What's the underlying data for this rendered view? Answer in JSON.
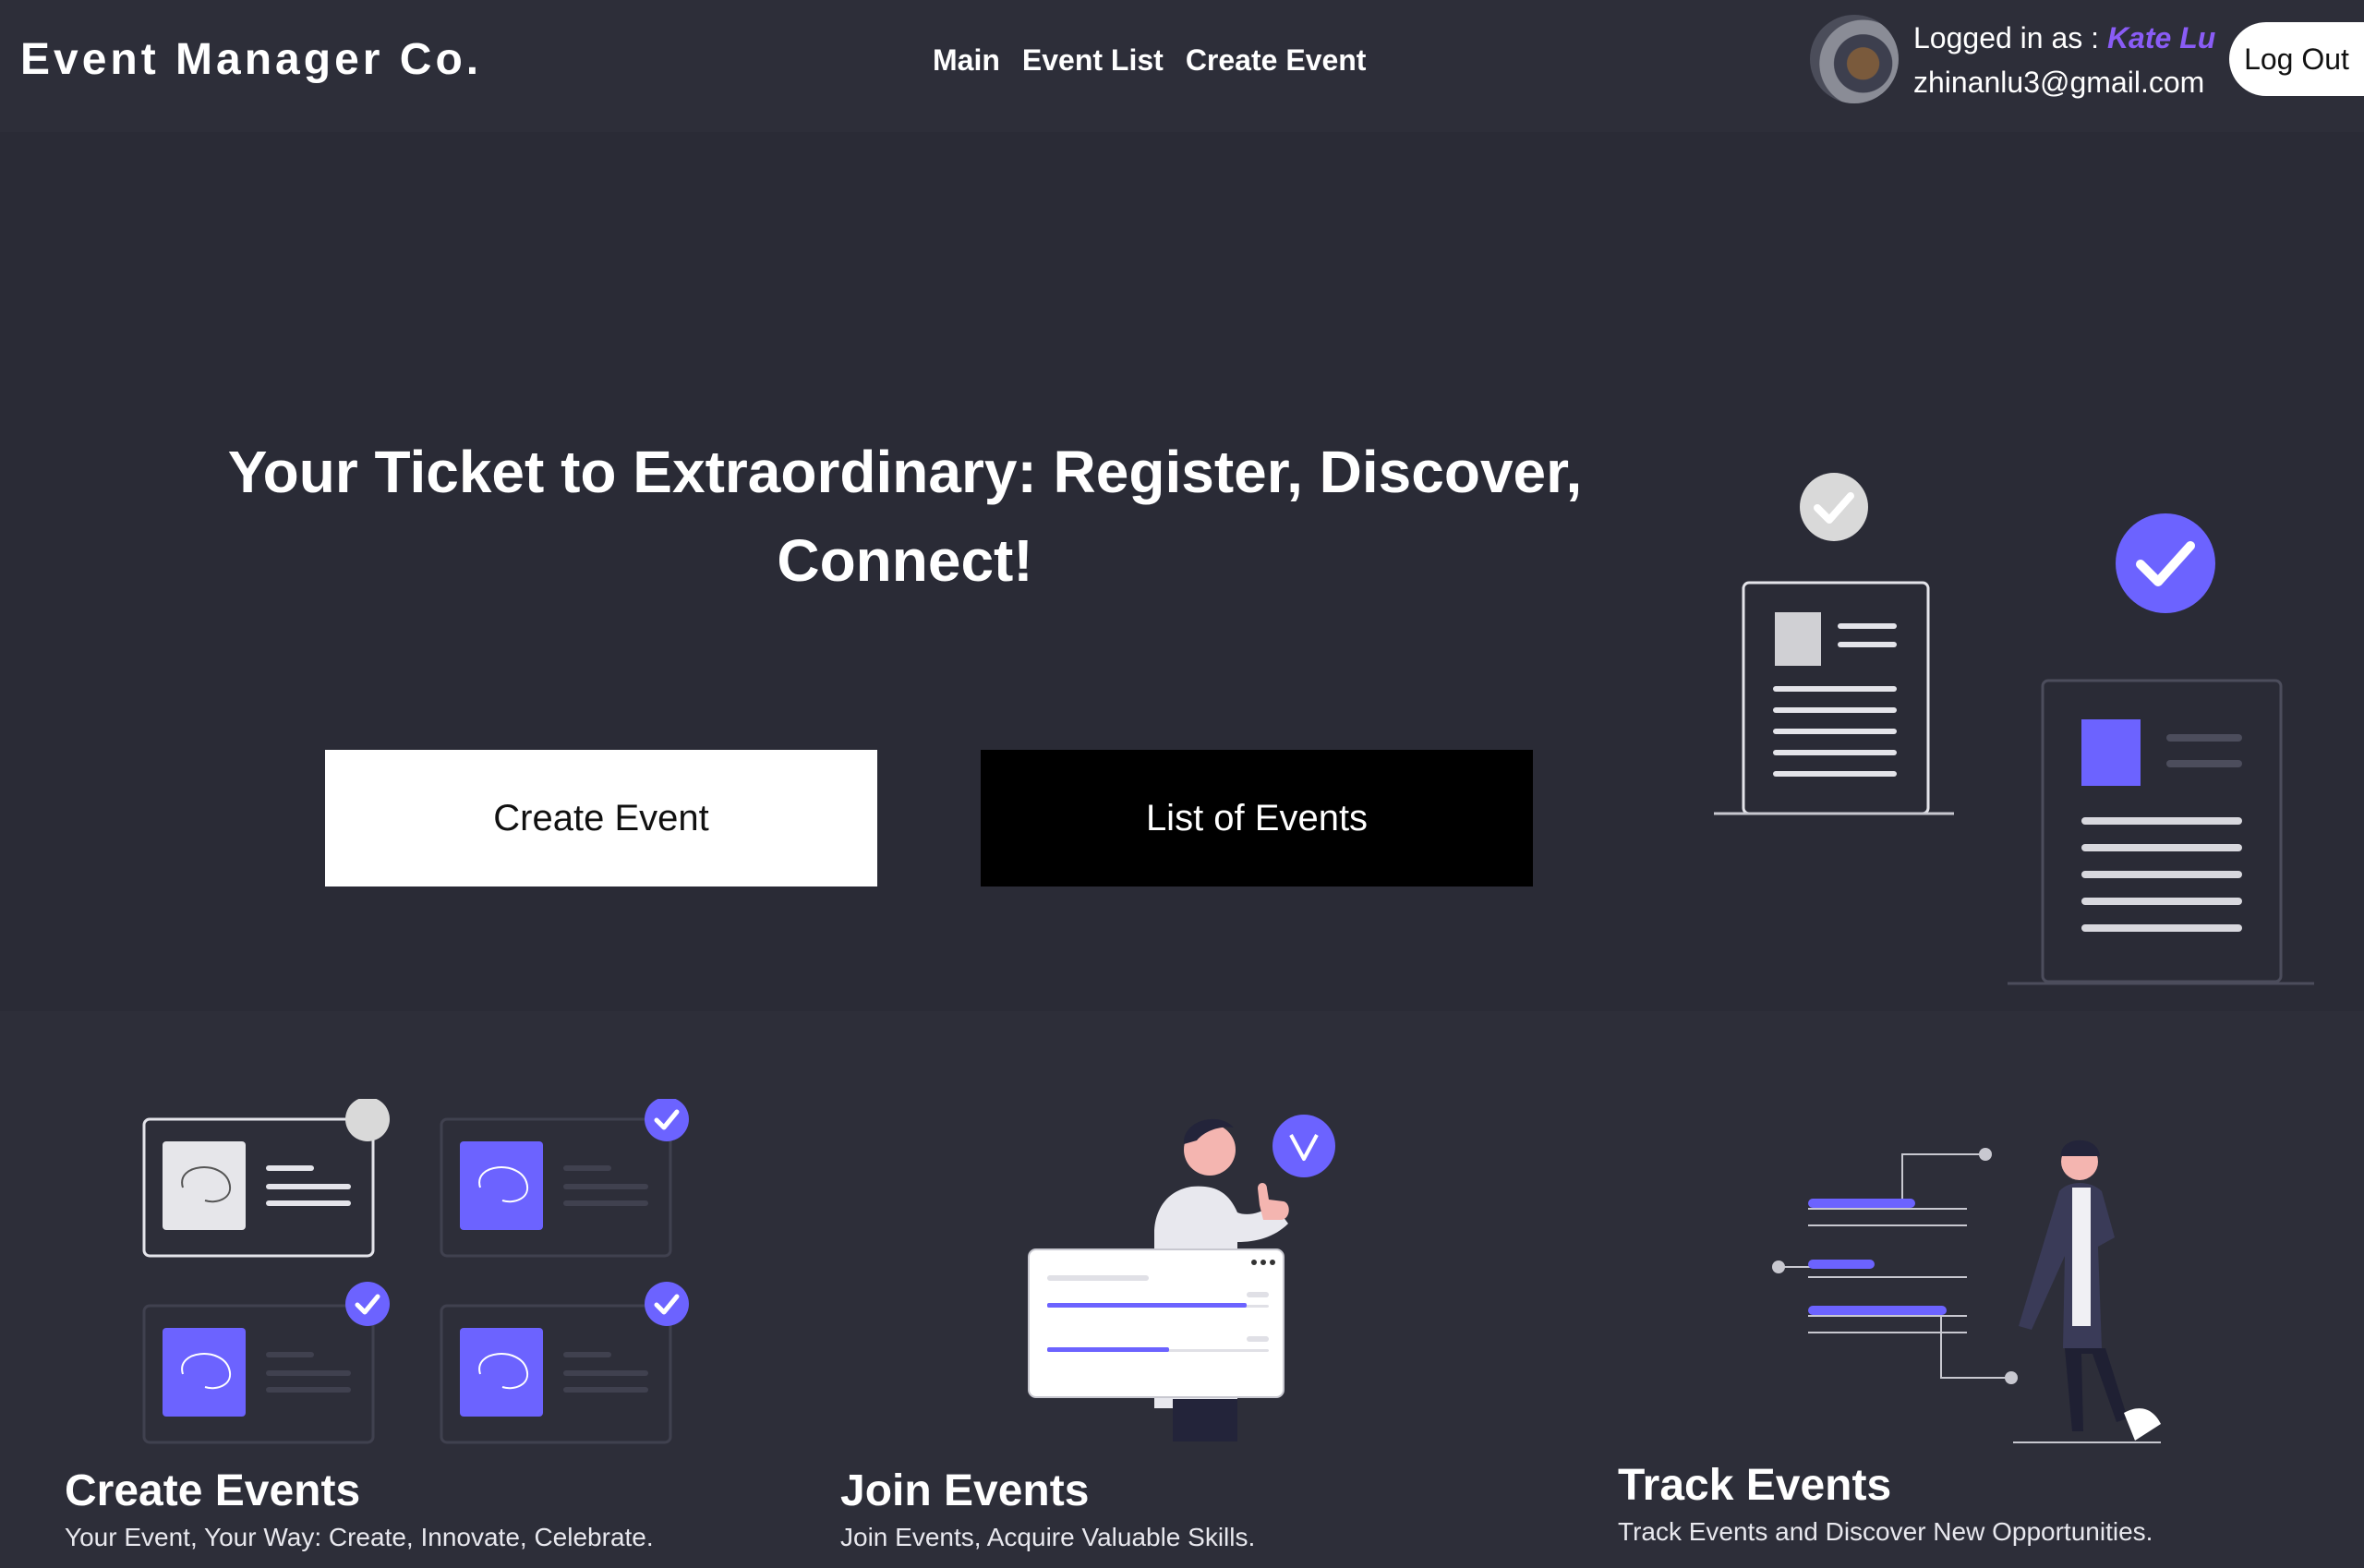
{
  "navbar": {
    "brand": "Event Manager Co.",
    "links": [
      "Main",
      "Event List",
      "Create Event"
    ],
    "user": {
      "logged_in_label": "Logged in as : ",
      "name": "Kate Lu",
      "email": "zhinanlu3@gmail.com"
    },
    "logout_label": "Log Out"
  },
  "hero": {
    "title": "Your Ticket to Extraordinary: Register, Discover, Connect!",
    "create_button": "Create Event",
    "list_button": "List of Events"
  },
  "features": [
    {
      "title": "Create Events",
      "description": "Your Event, Your Way: Create, Innovate, Celebrate."
    },
    {
      "title": "Join Events",
      "description": "Join Events, Acquire Valuable Skills."
    },
    {
      "title": "Track Events",
      "description": "Track Events and Discover New Opportunities."
    }
  ],
  "colors": {
    "accent": "#6c63ff",
    "user_name": "#8a5cf6",
    "hero_bg": "#2a2b36",
    "navbar_bg": "#2d2e39"
  }
}
